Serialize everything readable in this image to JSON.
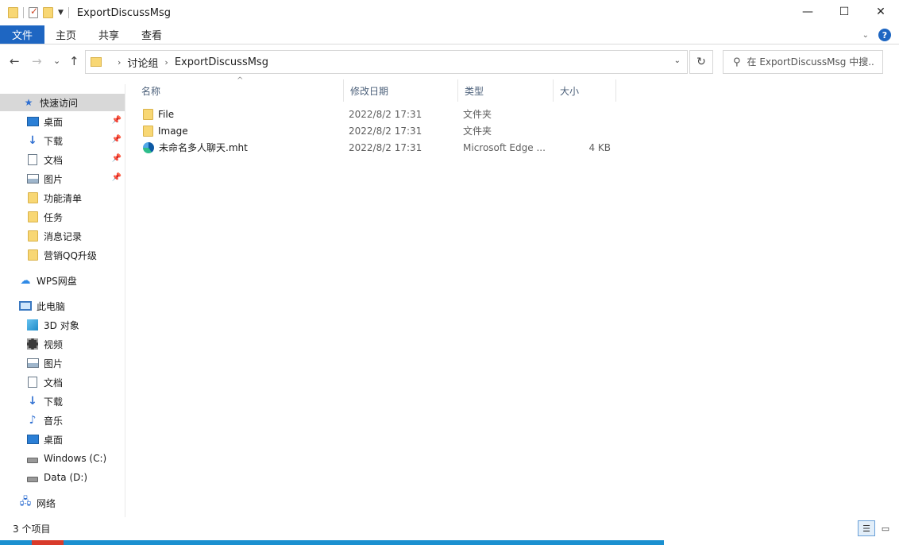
{
  "window": {
    "title": "ExportDiscussMsg",
    "minimize_glyph": "—",
    "maximize_glyph": "☐",
    "close_glyph": "✕"
  },
  "ribbon": {
    "tabs": [
      "文件",
      "主页",
      "共享",
      "查看"
    ],
    "help_glyph": "?",
    "collapse_glyph": "⌄"
  },
  "nav": {
    "back_glyph": "←",
    "forward_glyph": "→",
    "recent_glyph": "⌄",
    "up_glyph": "↑",
    "breadcrumb": [
      "讨论组",
      "ExportDiscussMsg"
    ],
    "crumb_sep": "›",
    "refresh_glyph": "↻",
    "search_placeholder": "在 ExportDiscussMsg 中搜..."
  },
  "sidebar": {
    "quick_access": "快速访问",
    "quick_items": [
      {
        "label": "桌面",
        "icon": "desktop-icon",
        "pinned": true
      },
      {
        "label": "下载",
        "icon": "download-icon",
        "pinned": true
      },
      {
        "label": "文档",
        "icon": "document-icon",
        "pinned": true
      },
      {
        "label": "图片",
        "icon": "picture-icon",
        "pinned": true
      },
      {
        "label": "功能清单",
        "icon": "folder-icon",
        "pinned": false
      },
      {
        "label": "任务",
        "icon": "folder-icon",
        "pinned": false
      },
      {
        "label": "消息记录",
        "icon": "folder-icon",
        "pinned": false
      },
      {
        "label": "营销QQ升级",
        "icon": "folder-icon",
        "pinned": false
      }
    ],
    "wps": "WPS网盘",
    "this_pc": "此电脑",
    "pc_items": [
      {
        "label": "3D 对象",
        "icon": "3d-objects-icon"
      },
      {
        "label": "视频",
        "icon": "video-icon"
      },
      {
        "label": "图片",
        "icon": "picture-icon"
      },
      {
        "label": "文档",
        "icon": "document-icon"
      },
      {
        "label": "下载",
        "icon": "download-icon"
      },
      {
        "label": "音乐",
        "icon": "music-icon"
      },
      {
        "label": "桌面",
        "icon": "desktop-icon"
      },
      {
        "label": "Windows (C:)",
        "icon": "drive-icon"
      },
      {
        "label": "Data (D:)",
        "icon": "drive-icon"
      }
    ],
    "network": "网络"
  },
  "columns": {
    "name": "名称",
    "date": "修改日期",
    "type": "类型",
    "size": "大小",
    "sort_glyph": "^"
  },
  "files": [
    {
      "name": "File",
      "date": "2022/8/2 17:31",
      "type": "文件夹",
      "size": "",
      "icon": "folder-icon"
    },
    {
      "name": "Image",
      "date": "2022/8/2 17:31",
      "type": "文件夹",
      "size": "",
      "icon": "folder-icon"
    },
    {
      "name": "未命名多人聊天.mht",
      "date": "2022/8/2 17:31",
      "type": "Microsoft Edge ...",
      "size": "4 KB",
      "icon": "edge-icon"
    }
  ],
  "status": {
    "count": "3 个项目",
    "details_glyph": "☰",
    "thumbs_glyph": "▭"
  }
}
